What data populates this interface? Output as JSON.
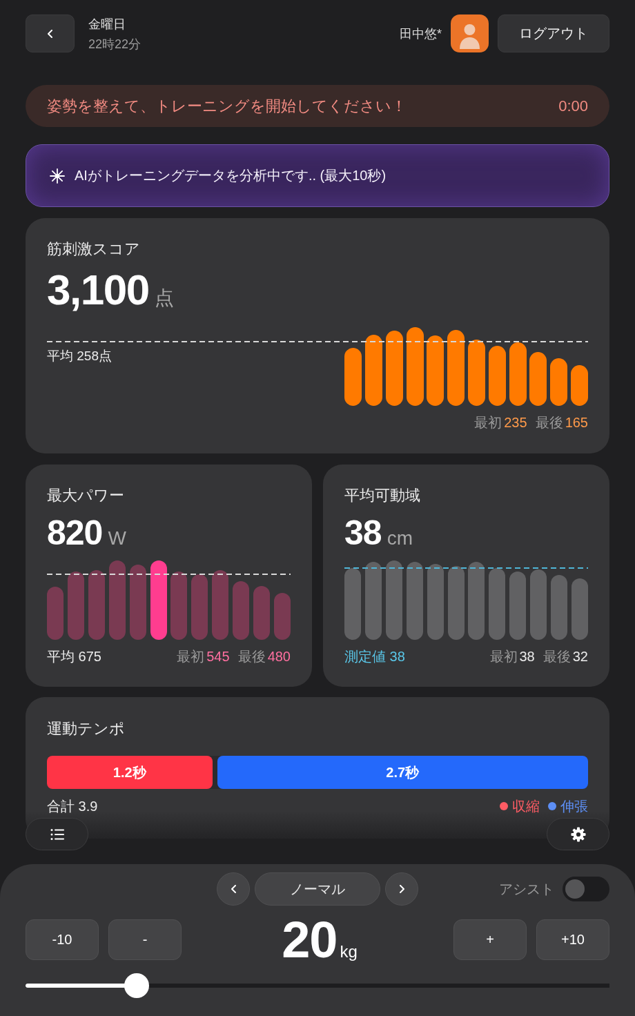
{
  "header": {
    "day": "金曜日",
    "time": "22時22分",
    "user_name": "田中悠*",
    "logout_button": "ログアウト"
  },
  "notice": {
    "message": "姿勢を整えて、トレーニングを開始してください！",
    "timer": "0:00"
  },
  "ai_status": {
    "message": "AIがトレーニングデータを分析中です.. (最大10秒)"
  },
  "score_card": {
    "title": "筋刺激スコア",
    "value": "3,100",
    "unit": "点",
    "average": "平均 258点",
    "stats": [
      {
        "label": "最初",
        "value": "235"
      },
      {
        "label": "最後",
        "value": "165"
      }
    ]
  },
  "power_card": {
    "title": "最大パワー",
    "value": "820",
    "unit": "W",
    "average": "平均 675",
    "stats": [
      {
        "label": "最初",
        "value": "545"
      },
      {
        "label": "最後",
        "value": "480"
      }
    ]
  },
  "range_card": {
    "title": "平均可動域",
    "value": "38",
    "unit": "cm",
    "measured": "測定値 38",
    "stats": [
      {
        "label": "最初",
        "value": "38"
      },
      {
        "label": "最後",
        "value": "32"
      }
    ]
  },
  "tempo_card": {
    "title": "運動テンポ",
    "segments": [
      {
        "label": "1.2秒",
        "level": 0.31,
        "color": "#ff3446"
      },
      {
        "label": "2.7秒",
        "level": 0.69,
        "color": "#2469fb"
      }
    ],
    "total": "合計 3.9",
    "legend": [
      {
        "label": "収縮",
        "color": "#ff5c64"
      },
      {
        "label": "伸張",
        "color": "#5d8ff5"
      }
    ]
  },
  "controls": {
    "mode": "ノーマル",
    "assist_label": "アシスト",
    "assist_on": false,
    "step_buttons": [
      "-10",
      "-",
      "+",
      "+10"
    ],
    "weight": "20",
    "weight_unit": "kg",
    "slider": {
      "level": 0.19
    }
  }
}
